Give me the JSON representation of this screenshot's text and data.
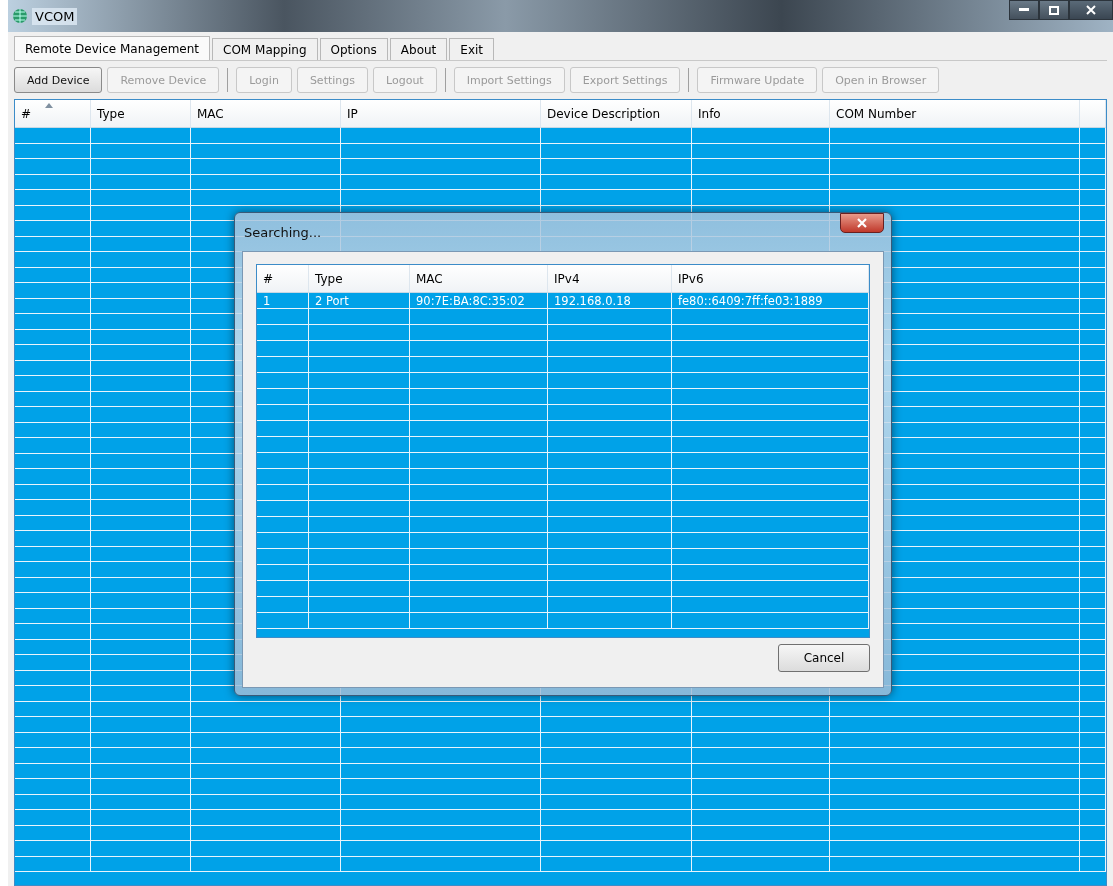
{
  "window": {
    "title": "VCOM"
  },
  "tabs": [
    {
      "label": "Remote Device Management",
      "selected": true
    },
    {
      "label": "COM Mapping",
      "selected": false
    },
    {
      "label": "Options",
      "selected": false
    },
    {
      "label": "About",
      "selected": false
    },
    {
      "label": "Exit",
      "selected": false
    }
  ],
  "toolbar": [
    {
      "kind": "button",
      "label": "Add Device",
      "disabled": false
    },
    {
      "kind": "button",
      "label": "Remove Device",
      "disabled": true
    },
    {
      "kind": "separator"
    },
    {
      "kind": "button",
      "label": "Login",
      "disabled": true
    },
    {
      "kind": "button",
      "label": "Settings",
      "disabled": true
    },
    {
      "kind": "button",
      "label": "Logout",
      "disabled": true
    },
    {
      "kind": "separator"
    },
    {
      "kind": "button",
      "label": "Import Settings",
      "disabled": true
    },
    {
      "kind": "button",
      "label": "Export Settings",
      "disabled": true
    },
    {
      "kind": "separator"
    },
    {
      "kind": "button",
      "label": "Firmware Update",
      "disabled": true
    },
    {
      "kind": "button",
      "label": "Open in Browser",
      "disabled": true
    }
  ],
  "table": {
    "columns": [
      "#",
      "Type",
      "MAC",
      "IP",
      "Device Description",
      "Info",
      "COM Number"
    ]
  },
  "dialog": {
    "title": "Searching...",
    "columns": [
      "#",
      "Type",
      "MAC",
      "IPv4",
      "IPv6"
    ],
    "rows": [
      [
        "1",
        "2 Port",
        "90:7E:BA:8C:35:02",
        "192.168.0.18",
        "fe80::6409:7ff:fe03:1889"
      ]
    ],
    "buttons": [
      "Cancel"
    ]
  }
}
